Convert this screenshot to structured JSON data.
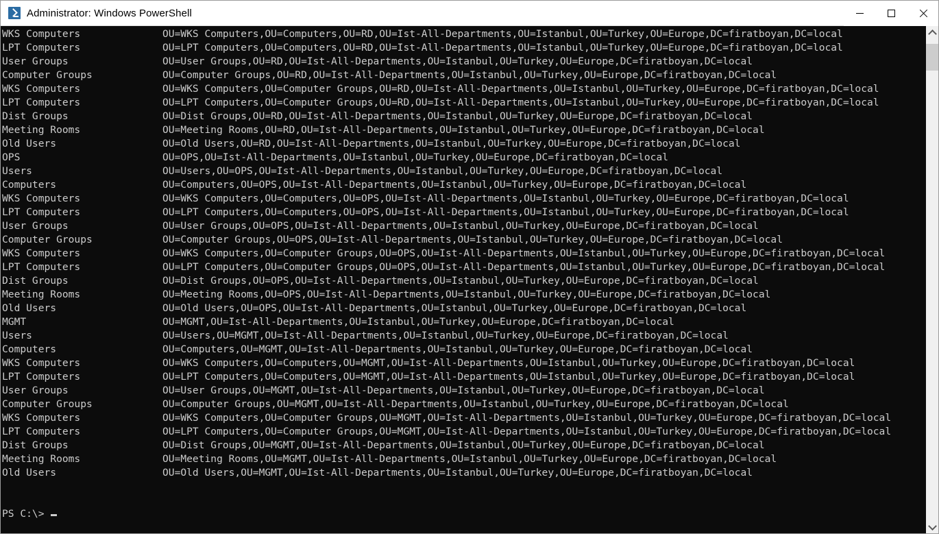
{
  "window": {
    "title": "Administrator: Windows PowerShell",
    "app_icon": "powershell-icon",
    "background_color": "#0c0c0c",
    "foreground_color": "#cccccc",
    "titlebar_background": "#ffffff"
  },
  "controls": {
    "minimize_label": "Minimize",
    "maximize_label": "Maximize",
    "close_label": "Close"
  },
  "scrollbar": {
    "up_arrow": "scroll-up-arrow",
    "down_arrow": "scroll-down-arrow",
    "thumb": "scroll-thumb"
  },
  "console": {
    "prompt": "PS C:\\> ",
    "cursor": "block-cursor",
    "lines": [
      {
        "name": "WKS Computers",
        "dn": "OU=WKS Computers,OU=Computers,OU=RD,OU=Ist-All-Departments,OU=Istanbul,OU=Turkey,OU=Europe,DC=firatboyan,DC=local"
      },
      {
        "name": "LPT Computers",
        "dn": "OU=LPT Computers,OU=Computers,OU=RD,OU=Ist-All-Departments,OU=Istanbul,OU=Turkey,OU=Europe,DC=firatboyan,DC=local"
      },
      {
        "name": "User Groups",
        "dn": "OU=User Groups,OU=RD,OU=Ist-All-Departments,OU=Istanbul,OU=Turkey,OU=Europe,DC=firatboyan,DC=local"
      },
      {
        "name": "Computer Groups",
        "dn": "OU=Computer Groups,OU=RD,OU=Ist-All-Departments,OU=Istanbul,OU=Turkey,OU=Europe,DC=firatboyan,DC=local"
      },
      {
        "name": "WKS Computers",
        "dn": "OU=WKS Computers,OU=Computer Groups,OU=RD,OU=Ist-All-Departments,OU=Istanbul,OU=Turkey,OU=Europe,DC=firatboyan,DC=local"
      },
      {
        "name": "LPT Computers",
        "dn": "OU=LPT Computers,OU=Computer Groups,OU=RD,OU=Ist-All-Departments,OU=Istanbul,OU=Turkey,OU=Europe,DC=firatboyan,DC=local"
      },
      {
        "name": "Dist Groups",
        "dn": "OU=Dist Groups,OU=RD,OU=Ist-All-Departments,OU=Istanbul,OU=Turkey,OU=Europe,DC=firatboyan,DC=local"
      },
      {
        "name": "Meeting Rooms",
        "dn": "OU=Meeting Rooms,OU=RD,OU=Ist-All-Departments,OU=Istanbul,OU=Turkey,OU=Europe,DC=firatboyan,DC=local"
      },
      {
        "name": "Old Users",
        "dn": "OU=Old Users,OU=RD,OU=Ist-All-Departments,OU=Istanbul,OU=Turkey,OU=Europe,DC=firatboyan,DC=local"
      },
      {
        "name": "OPS",
        "dn": "OU=OPS,OU=Ist-All-Departments,OU=Istanbul,OU=Turkey,OU=Europe,DC=firatboyan,DC=local"
      },
      {
        "name": "Users",
        "dn": "OU=Users,OU=OPS,OU=Ist-All-Departments,OU=Istanbul,OU=Turkey,OU=Europe,DC=firatboyan,DC=local"
      },
      {
        "name": "Computers",
        "dn": "OU=Computers,OU=OPS,OU=Ist-All-Departments,OU=Istanbul,OU=Turkey,OU=Europe,DC=firatboyan,DC=local"
      },
      {
        "name": "WKS Computers",
        "dn": "OU=WKS Computers,OU=Computers,OU=OPS,OU=Ist-All-Departments,OU=Istanbul,OU=Turkey,OU=Europe,DC=firatboyan,DC=local"
      },
      {
        "name": "LPT Computers",
        "dn": "OU=LPT Computers,OU=Computers,OU=OPS,OU=Ist-All-Departments,OU=Istanbul,OU=Turkey,OU=Europe,DC=firatboyan,DC=local"
      },
      {
        "name": "User Groups",
        "dn": "OU=User Groups,OU=OPS,OU=Ist-All-Departments,OU=Istanbul,OU=Turkey,OU=Europe,DC=firatboyan,DC=local"
      },
      {
        "name": "Computer Groups",
        "dn": "OU=Computer Groups,OU=OPS,OU=Ist-All-Departments,OU=Istanbul,OU=Turkey,OU=Europe,DC=firatboyan,DC=local"
      },
      {
        "name": "WKS Computers",
        "dn": "OU=WKS Computers,OU=Computer Groups,OU=OPS,OU=Ist-All-Departments,OU=Istanbul,OU=Turkey,OU=Europe,DC=firatboyan,DC=local"
      },
      {
        "name": "LPT Computers",
        "dn": "OU=LPT Computers,OU=Computer Groups,OU=OPS,OU=Ist-All-Departments,OU=Istanbul,OU=Turkey,OU=Europe,DC=firatboyan,DC=local"
      },
      {
        "name": "Dist Groups",
        "dn": "OU=Dist Groups,OU=OPS,OU=Ist-All-Departments,OU=Istanbul,OU=Turkey,OU=Europe,DC=firatboyan,DC=local"
      },
      {
        "name": "Meeting Rooms",
        "dn": "OU=Meeting Rooms,OU=OPS,OU=Ist-All-Departments,OU=Istanbul,OU=Turkey,OU=Europe,DC=firatboyan,DC=local"
      },
      {
        "name": "Old Users",
        "dn": "OU=Old Users,OU=OPS,OU=Ist-All-Departments,OU=Istanbul,OU=Turkey,OU=Europe,DC=firatboyan,DC=local"
      },
      {
        "name": "MGMT",
        "dn": "OU=MGMT,OU=Ist-All-Departments,OU=Istanbul,OU=Turkey,OU=Europe,DC=firatboyan,DC=local"
      },
      {
        "name": "Users",
        "dn": "OU=Users,OU=MGMT,OU=Ist-All-Departments,OU=Istanbul,OU=Turkey,OU=Europe,DC=firatboyan,DC=local"
      },
      {
        "name": "Computers",
        "dn": "OU=Computers,OU=MGMT,OU=Ist-All-Departments,OU=Istanbul,OU=Turkey,OU=Europe,DC=firatboyan,DC=local"
      },
      {
        "name": "WKS Computers",
        "dn": "OU=WKS Computers,OU=Computers,OU=MGMT,OU=Ist-All-Departments,OU=Istanbul,OU=Turkey,OU=Europe,DC=firatboyan,DC=local"
      },
      {
        "name": "LPT Computers",
        "dn": "OU=LPT Computers,OU=Computers,OU=MGMT,OU=Ist-All-Departments,OU=Istanbul,OU=Turkey,OU=Europe,DC=firatboyan,DC=local"
      },
      {
        "name": "User Groups",
        "dn": "OU=User Groups,OU=MGMT,OU=Ist-All-Departments,OU=Istanbul,OU=Turkey,OU=Europe,DC=firatboyan,DC=local"
      },
      {
        "name": "Computer Groups",
        "dn": "OU=Computer Groups,OU=MGMT,OU=Ist-All-Departments,OU=Istanbul,OU=Turkey,OU=Europe,DC=firatboyan,DC=local"
      },
      {
        "name": "WKS Computers",
        "dn": "OU=WKS Computers,OU=Computer Groups,OU=MGMT,OU=Ist-All-Departments,OU=Istanbul,OU=Turkey,OU=Europe,DC=firatboyan,DC=local"
      },
      {
        "name": "LPT Computers",
        "dn": "OU=LPT Computers,OU=Computer Groups,OU=MGMT,OU=Ist-All-Departments,OU=Istanbul,OU=Turkey,OU=Europe,DC=firatboyan,DC=local"
      },
      {
        "name": "Dist Groups",
        "dn": "OU=Dist Groups,OU=MGMT,OU=Ist-All-Departments,OU=Istanbul,OU=Turkey,OU=Europe,DC=firatboyan,DC=local"
      },
      {
        "name": "Meeting Rooms",
        "dn": "OU=Meeting Rooms,OU=MGMT,OU=Ist-All-Departments,OU=Istanbul,OU=Turkey,OU=Europe,DC=firatboyan,DC=local"
      },
      {
        "name": "Old Users",
        "dn": "OU=Old Users,OU=MGMT,OU=Ist-All-Departments,OU=Istanbul,OU=Turkey,OU=Europe,DC=firatboyan,DC=local"
      }
    ]
  }
}
